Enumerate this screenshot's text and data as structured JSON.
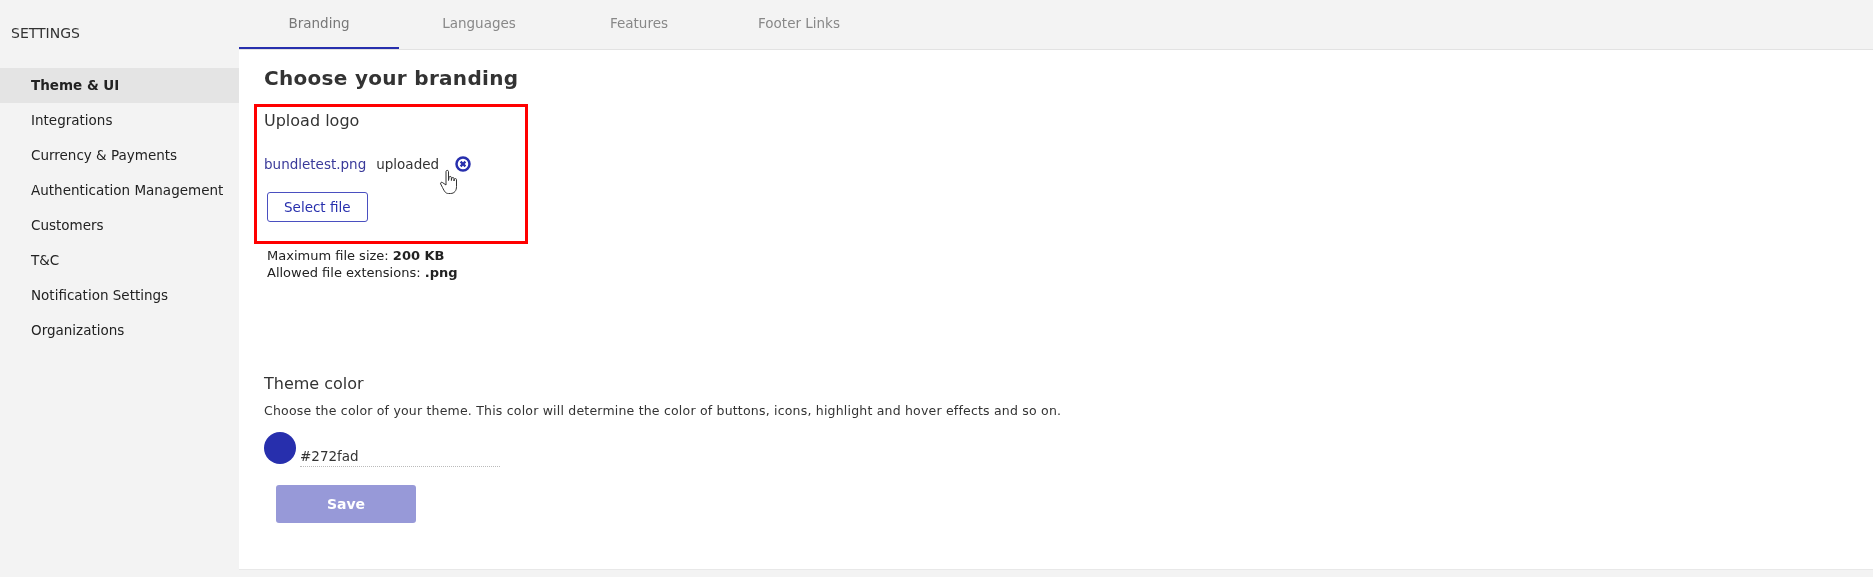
{
  "sidebar": {
    "title": "SETTINGS",
    "items": [
      {
        "label": "Theme & UI",
        "selected": true
      },
      {
        "label": "Integrations",
        "selected": false
      },
      {
        "label": "Currency & Payments",
        "selected": false
      },
      {
        "label": "Authentication Management",
        "selected": false
      },
      {
        "label": "Customers",
        "selected": false
      },
      {
        "label": "T&C",
        "selected": false
      },
      {
        "label": "Notification Settings",
        "selected": false
      },
      {
        "label": "Organizations",
        "selected": false
      }
    ]
  },
  "tabs": [
    {
      "label": "Branding",
      "selected": true
    },
    {
      "label": "Languages",
      "selected": false
    },
    {
      "label": "Features",
      "selected": false
    },
    {
      "label": "Footer Links",
      "selected": false
    }
  ],
  "heading": "Choose your branding",
  "upload": {
    "title": "Upload logo",
    "file_name": "bundletest.png",
    "status": "uploaded",
    "button": "Select file",
    "max_size": "Maximum file size: **200 KB**",
    "extensions": "Allowed file extensions: **.png**"
  },
  "theme": {
    "title": "Theme color",
    "description": "Choose the color of your theme. This color will determine the color of buttons, icons, highlight and hover effects and so on.",
    "color": "#272fad",
    "value": "#272fad"
  },
  "save": {
    "label": "Save",
    "disabled": true
  }
}
